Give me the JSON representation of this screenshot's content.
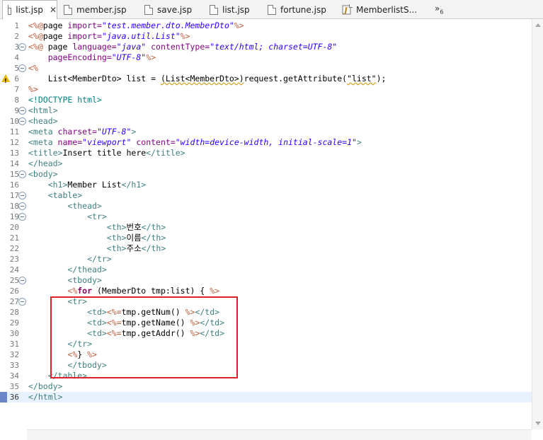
{
  "tabs": [
    {
      "label": "list.jsp",
      "active": true,
      "icon": "file-icon",
      "close": "✕"
    },
    {
      "label": "member.jsp",
      "active": false,
      "icon": "file-icon"
    },
    {
      "label": "save.jsp",
      "active": false,
      "icon": "file-icon"
    },
    {
      "label": "list.jsp",
      "active": false,
      "icon": "file-icon"
    },
    {
      "label": "fortune.jsp",
      "active": false,
      "icon": "file-icon"
    },
    {
      "label": "MemberlistS...",
      "active": false,
      "icon": "java-file-icon"
    }
  ],
  "overflow_label": "»",
  "overflow_count": "6",
  "current_line": 36,
  "highlight_color": "#e0212d",
  "lines": [
    {
      "n": "1",
      "fold": false,
      "tokens": [
        [
          "jsp",
          "<%@"
        ],
        [
          "t",
          "page "
        ],
        [
          "attr",
          "import="
        ],
        [
          "str",
          "\"test.member.dto.MemberDto\""
        ],
        [
          "jsp",
          "%>"
        ]
      ]
    },
    {
      "n": "2",
      "fold": false,
      "tokens": [
        [
          "jsp",
          "<%@"
        ],
        [
          "t",
          "page "
        ],
        [
          "attr",
          "import="
        ],
        [
          "str",
          "\"java.util.List\""
        ],
        [
          "jsp",
          "%>"
        ]
      ]
    },
    {
      "n": "3",
      "fold": true,
      "tokens": [
        [
          "jsp",
          "<%@ "
        ],
        [
          "t",
          "page "
        ],
        [
          "attr",
          "language="
        ],
        [
          "str",
          "\"java\""
        ],
        [
          "t",
          " "
        ],
        [
          "attr",
          "contentType="
        ],
        [
          "str",
          "\"text/html; charset=UTF-8\""
        ]
      ]
    },
    {
      "n": "4",
      "fold": false,
      "tokens": [
        [
          "t",
          "    "
        ],
        [
          "attr",
          "pageEncoding="
        ],
        [
          "str",
          "\"UTF-8\""
        ],
        [
          "jsp",
          "%>"
        ]
      ]
    },
    {
      "n": "5",
      "fold": true,
      "tokens": [
        [
          "jsp",
          "<%"
        ]
      ]
    },
    {
      "n": "6",
      "fold": false,
      "warn": true,
      "tokens": [
        [
          "t",
          "    List<MemberDto> list = "
        ],
        [
          "w",
          "(List<MemberDto>)"
        ],
        [
          "t",
          "request.getAttribute("
        ],
        [
          "w",
          "\"list\""
        ],
        [
          "t",
          ");"
        ]
      ]
    },
    {
      "n": "7",
      "fold": false,
      "tokens": [
        [
          "jsp",
          "%>"
        ]
      ]
    },
    {
      "n": "8",
      "fold": false,
      "tokens": [
        [
          "dt",
          "<!DOCTYPE html>"
        ]
      ]
    },
    {
      "n": "9",
      "fold": true,
      "tokens": [
        [
          "tag",
          "<html>"
        ]
      ]
    },
    {
      "n": "10",
      "fold": true,
      "tokens": [
        [
          "tag",
          "<head>"
        ]
      ]
    },
    {
      "n": "11",
      "fold": false,
      "tokens": [
        [
          "tag",
          "<meta "
        ],
        [
          "attr",
          "charset="
        ],
        [
          "str",
          "\"UTF-8\""
        ],
        [
          "tag",
          ">"
        ]
      ]
    },
    {
      "n": "12",
      "fold": false,
      "tokens": [
        [
          "tag",
          "<meta "
        ],
        [
          "attr",
          "name="
        ],
        [
          "str",
          "\"viewport\""
        ],
        [
          "t",
          " "
        ],
        [
          "attr",
          "content="
        ],
        [
          "str",
          "\"width=device-width, initial-scale=1\""
        ],
        [
          "tag",
          ">"
        ]
      ]
    },
    {
      "n": "13",
      "fold": false,
      "tokens": [
        [
          "tag",
          "<title>"
        ],
        [
          "t",
          "Insert title here"
        ],
        [
          "tag",
          "</title>"
        ]
      ]
    },
    {
      "n": "14",
      "fold": false,
      "tokens": [
        [
          "tag",
          "</head>"
        ]
      ]
    },
    {
      "n": "15",
      "fold": true,
      "tokens": [
        [
          "tag",
          "<body>"
        ]
      ]
    },
    {
      "n": "16",
      "fold": false,
      "tokens": [
        [
          "t",
          "    "
        ],
        [
          "tag",
          "<h1>"
        ],
        [
          "t",
          "Member List"
        ],
        [
          "tag",
          "</h1>"
        ]
      ]
    },
    {
      "n": "17",
      "fold": true,
      "tokens": [
        [
          "t",
          "    "
        ],
        [
          "tag",
          "<table>"
        ]
      ]
    },
    {
      "n": "18",
      "fold": true,
      "tokens": [
        [
          "t",
          "        "
        ],
        [
          "tag",
          "<thead>"
        ]
      ]
    },
    {
      "n": "19",
      "fold": true,
      "tokens": [
        [
          "t",
          "            "
        ],
        [
          "tag",
          "<tr>"
        ]
      ]
    },
    {
      "n": "20",
      "fold": false,
      "tokens": [
        [
          "t",
          "                "
        ],
        [
          "tag",
          "<th>"
        ],
        [
          "t",
          "번호"
        ],
        [
          "tag",
          "</th>"
        ]
      ]
    },
    {
      "n": "21",
      "fold": false,
      "tokens": [
        [
          "t",
          "                "
        ],
        [
          "tag",
          "<th>"
        ],
        [
          "t",
          "이름"
        ],
        [
          "tag",
          "</th>"
        ]
      ]
    },
    {
      "n": "22",
      "fold": false,
      "tokens": [
        [
          "t",
          "                "
        ],
        [
          "tag",
          "<th>"
        ],
        [
          "t",
          "주소"
        ],
        [
          "tag",
          "</th>"
        ]
      ]
    },
    {
      "n": "23",
      "fold": false,
      "tokens": [
        [
          "t",
          "            "
        ],
        [
          "tag",
          "</tr>"
        ]
      ]
    },
    {
      "n": "24",
      "fold": false,
      "tokens": [
        [
          "t",
          "        "
        ],
        [
          "tag",
          "</thead>"
        ]
      ]
    },
    {
      "n": "25",
      "fold": true,
      "tokens": [
        [
          "t",
          "        "
        ],
        [
          "tag",
          "<tbody>"
        ]
      ]
    },
    {
      "n": "26",
      "fold": false,
      "tokens": [
        [
          "t",
          "        "
        ],
        [
          "jsp",
          "<%"
        ],
        [
          "kw",
          "for"
        ],
        [
          "t",
          " (MemberDto tmp:list) { "
        ],
        [
          "jsp",
          "%>"
        ]
      ]
    },
    {
      "n": "27",
      "fold": true,
      "tokens": [
        [
          "t",
          "        "
        ],
        [
          "tag",
          "<tr>"
        ]
      ]
    },
    {
      "n": "28",
      "fold": false,
      "tokens": [
        [
          "t",
          "            "
        ],
        [
          "tag",
          "<td>"
        ],
        [
          "jsp",
          "<%="
        ],
        [
          "t",
          "tmp.getNum() "
        ],
        [
          "jsp",
          "%>"
        ],
        [
          "tag",
          "</td>"
        ]
      ]
    },
    {
      "n": "29",
      "fold": false,
      "tokens": [
        [
          "t",
          "            "
        ],
        [
          "tag",
          "<td>"
        ],
        [
          "jsp",
          "<%="
        ],
        [
          "t",
          "tmp.getName() "
        ],
        [
          "jsp",
          "%>"
        ],
        [
          "tag",
          "</td>"
        ]
      ]
    },
    {
      "n": "30",
      "fold": false,
      "tokens": [
        [
          "t",
          "            "
        ],
        [
          "tag",
          "<td>"
        ],
        [
          "jsp",
          "<%="
        ],
        [
          "t",
          "tmp.getAddr() "
        ],
        [
          "jsp",
          "%>"
        ],
        [
          "tag",
          "</td>"
        ]
      ]
    },
    {
      "n": "31",
      "fold": false,
      "tokens": [
        [
          "t",
          "        "
        ],
        [
          "tag",
          "</tr>"
        ]
      ]
    },
    {
      "n": "32",
      "fold": false,
      "tokens": [
        [
          "t",
          "        "
        ],
        [
          "jsp",
          "<%"
        ],
        [
          "t",
          "} "
        ],
        [
          "jsp",
          "%>"
        ]
      ]
    },
    {
      "n": "33",
      "fold": false,
      "tokens": [
        [
          "t",
          "        "
        ],
        [
          "tag",
          "</tbody>"
        ]
      ]
    },
    {
      "n": "34",
      "fold": false,
      "tokens": [
        [
          "t",
          "    "
        ],
        [
          "tag",
          "</table>"
        ]
      ]
    },
    {
      "n": "35",
      "fold": false,
      "tokens": [
        [
          "tag",
          "</body>"
        ]
      ]
    },
    {
      "n": "36",
      "fold": false,
      "tokens": [
        [
          "tag",
          "</html>"
        ]
      ]
    }
  ]
}
